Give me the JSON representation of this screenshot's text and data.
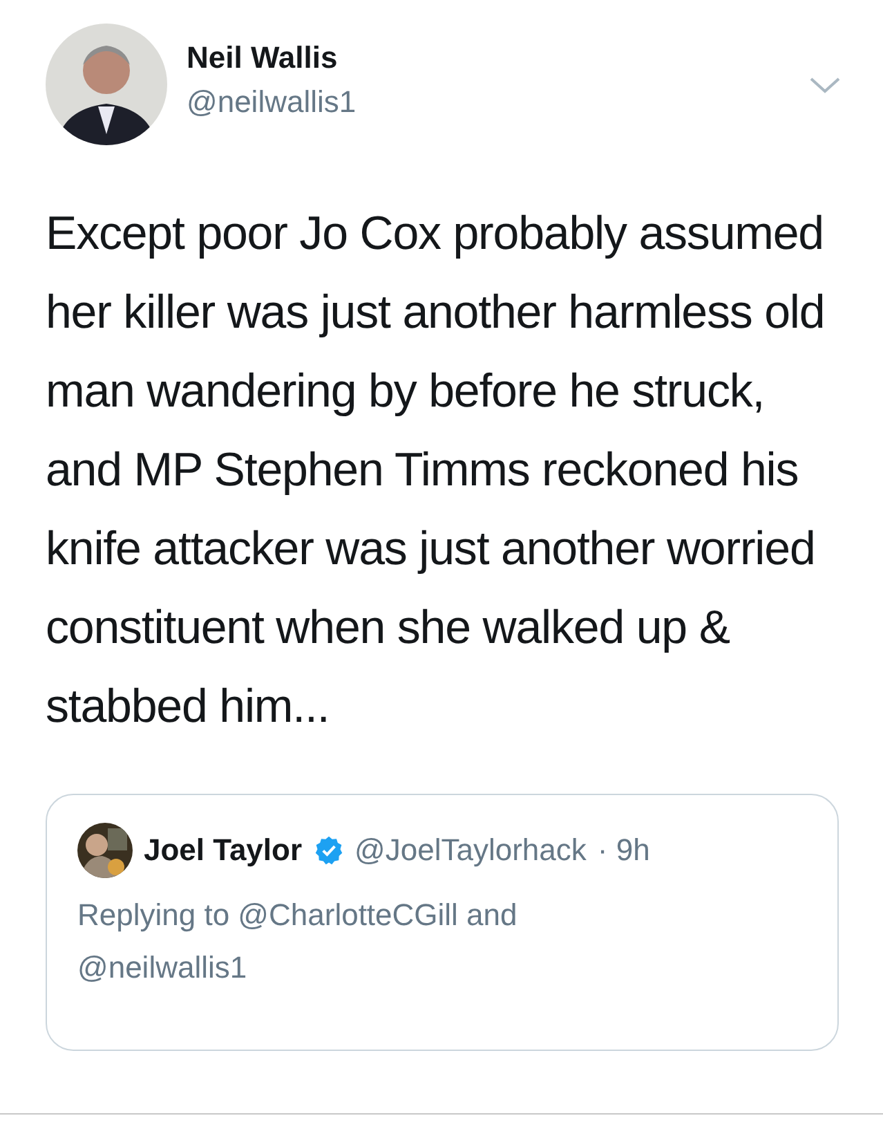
{
  "tweet": {
    "author": {
      "name": "Neil Wallis",
      "handle": "@neilwallis1"
    },
    "text": "Except poor Jo Cox probably assumed her killer was just another harmless old man wandering by before he struck, and MP Stephen Timms reckoned his knife attacker was just another worried constituent when she walked up & stabbed him...",
    "quoted": {
      "author": {
        "name": "Joel Taylor",
        "verified": true,
        "handle": "@JoelTaylorhack",
        "time": "· 9h"
      },
      "reply_prefix": "Replying to",
      "reply_to": [
        "@CharlotteCGill",
        "@neilwallis1"
      ],
      "reply_joiner": "and"
    }
  }
}
